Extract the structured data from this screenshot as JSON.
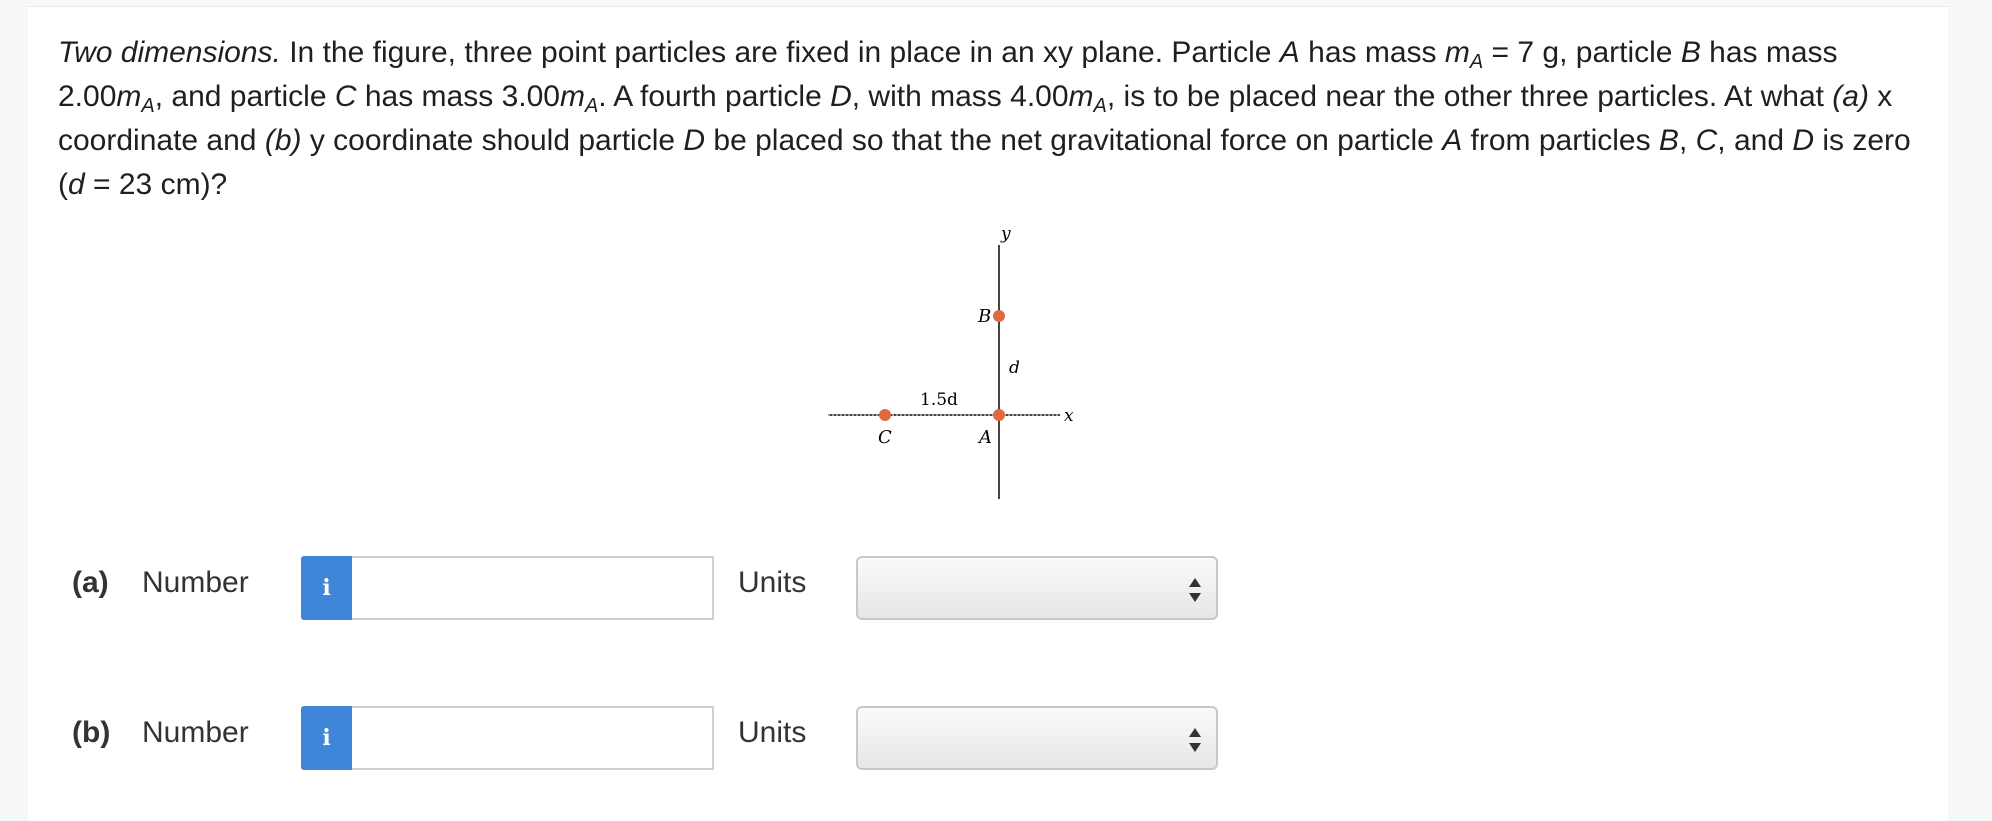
{
  "question": {
    "lead_italic": "Two dimensions.",
    "text_1": " In the figure, three point particles are fixed in place in an xy plane. Particle ",
    "A": "A",
    "text_2": " has mass ",
    "m": "m",
    "sub_A": "A",
    "text_3": " = 7 g, particle ",
    "B": "B",
    "text_4": " has mass 2.00",
    "text_5": ", and particle ",
    "C": "C",
    "text_6": " has mass 3.00",
    "text_7": ". A fourth particle ",
    "D": "D",
    "text_8": ", with mass 4.00",
    "text_9": ", is to be placed near the other three particles. At what ",
    "part_a": "(a)",
    "text_10": " x coordinate and ",
    "part_b": "(b)",
    "text_11": " y coordinate should particle ",
    "text_12": " be placed so that the net gravitational force on particle ",
    "text_13": " from particles ",
    "text_14": ", ",
    "text_15": ", and ",
    "text_16": " is zero (",
    "d": "d",
    "text_17": " = 23 cm)?"
  },
  "figure": {
    "y_axis_label": "y",
    "x_axis_label": "x",
    "label_B": "B",
    "label_A": "A",
    "label_C": "C",
    "label_d": "d",
    "label_15d": "1.5d",
    "particle_color": "#e06a3f"
  },
  "answers": [
    {
      "part": "(a)",
      "number_label": "Number",
      "info_icon": "i",
      "units_label": "Units",
      "value": "",
      "selected_unit": ""
    },
    {
      "part": "(b)",
      "number_label": "Number",
      "info_icon": "i",
      "units_label": "Units",
      "value": "",
      "selected_unit": ""
    }
  ],
  "colors": {
    "info_button": "#3f86d8",
    "background": "#f6f7f8"
  }
}
